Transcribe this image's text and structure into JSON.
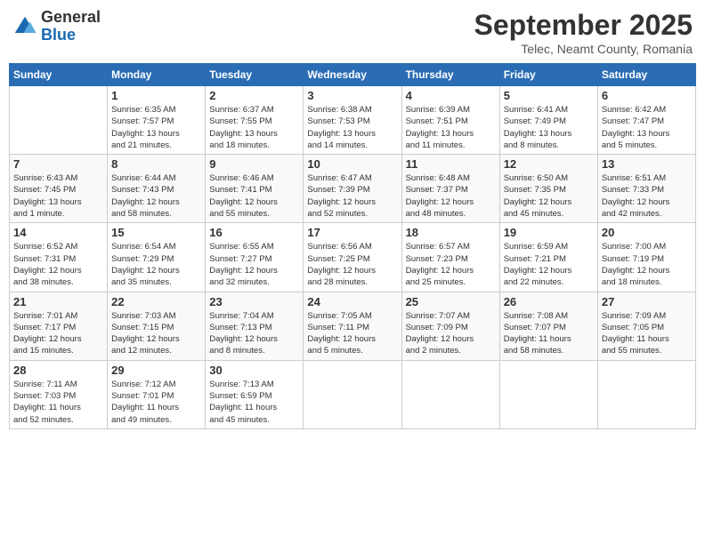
{
  "header": {
    "logo_general": "General",
    "logo_blue": "Blue",
    "month_title": "September 2025",
    "subtitle": "Telec, Neamt County, Romania"
  },
  "days_of_week": [
    "Sunday",
    "Monday",
    "Tuesday",
    "Wednesday",
    "Thursday",
    "Friday",
    "Saturday"
  ],
  "weeks": [
    [
      {
        "day": "",
        "info": ""
      },
      {
        "day": "1",
        "info": "Sunrise: 6:35 AM\nSunset: 7:57 PM\nDaylight: 13 hours\nand 21 minutes."
      },
      {
        "day": "2",
        "info": "Sunrise: 6:37 AM\nSunset: 7:55 PM\nDaylight: 13 hours\nand 18 minutes."
      },
      {
        "day": "3",
        "info": "Sunrise: 6:38 AM\nSunset: 7:53 PM\nDaylight: 13 hours\nand 14 minutes."
      },
      {
        "day": "4",
        "info": "Sunrise: 6:39 AM\nSunset: 7:51 PM\nDaylight: 13 hours\nand 11 minutes."
      },
      {
        "day": "5",
        "info": "Sunrise: 6:41 AM\nSunset: 7:49 PM\nDaylight: 13 hours\nand 8 minutes."
      },
      {
        "day": "6",
        "info": "Sunrise: 6:42 AM\nSunset: 7:47 PM\nDaylight: 13 hours\nand 5 minutes."
      }
    ],
    [
      {
        "day": "7",
        "info": "Sunrise: 6:43 AM\nSunset: 7:45 PM\nDaylight: 13 hours\nand 1 minute."
      },
      {
        "day": "8",
        "info": "Sunrise: 6:44 AM\nSunset: 7:43 PM\nDaylight: 12 hours\nand 58 minutes."
      },
      {
        "day": "9",
        "info": "Sunrise: 6:46 AM\nSunset: 7:41 PM\nDaylight: 12 hours\nand 55 minutes."
      },
      {
        "day": "10",
        "info": "Sunrise: 6:47 AM\nSunset: 7:39 PM\nDaylight: 12 hours\nand 52 minutes."
      },
      {
        "day": "11",
        "info": "Sunrise: 6:48 AM\nSunset: 7:37 PM\nDaylight: 12 hours\nand 48 minutes."
      },
      {
        "day": "12",
        "info": "Sunrise: 6:50 AM\nSunset: 7:35 PM\nDaylight: 12 hours\nand 45 minutes."
      },
      {
        "day": "13",
        "info": "Sunrise: 6:51 AM\nSunset: 7:33 PM\nDaylight: 12 hours\nand 42 minutes."
      }
    ],
    [
      {
        "day": "14",
        "info": "Sunrise: 6:52 AM\nSunset: 7:31 PM\nDaylight: 12 hours\nand 38 minutes."
      },
      {
        "day": "15",
        "info": "Sunrise: 6:54 AM\nSunset: 7:29 PM\nDaylight: 12 hours\nand 35 minutes."
      },
      {
        "day": "16",
        "info": "Sunrise: 6:55 AM\nSunset: 7:27 PM\nDaylight: 12 hours\nand 32 minutes."
      },
      {
        "day": "17",
        "info": "Sunrise: 6:56 AM\nSunset: 7:25 PM\nDaylight: 12 hours\nand 28 minutes."
      },
      {
        "day": "18",
        "info": "Sunrise: 6:57 AM\nSunset: 7:23 PM\nDaylight: 12 hours\nand 25 minutes."
      },
      {
        "day": "19",
        "info": "Sunrise: 6:59 AM\nSunset: 7:21 PM\nDaylight: 12 hours\nand 22 minutes."
      },
      {
        "day": "20",
        "info": "Sunrise: 7:00 AM\nSunset: 7:19 PM\nDaylight: 12 hours\nand 18 minutes."
      }
    ],
    [
      {
        "day": "21",
        "info": "Sunrise: 7:01 AM\nSunset: 7:17 PM\nDaylight: 12 hours\nand 15 minutes."
      },
      {
        "day": "22",
        "info": "Sunrise: 7:03 AM\nSunset: 7:15 PM\nDaylight: 12 hours\nand 12 minutes."
      },
      {
        "day": "23",
        "info": "Sunrise: 7:04 AM\nSunset: 7:13 PM\nDaylight: 12 hours\nand 8 minutes."
      },
      {
        "day": "24",
        "info": "Sunrise: 7:05 AM\nSunset: 7:11 PM\nDaylight: 12 hours\nand 5 minutes."
      },
      {
        "day": "25",
        "info": "Sunrise: 7:07 AM\nSunset: 7:09 PM\nDaylight: 12 hours\nand 2 minutes."
      },
      {
        "day": "26",
        "info": "Sunrise: 7:08 AM\nSunset: 7:07 PM\nDaylight: 11 hours\nand 58 minutes."
      },
      {
        "day": "27",
        "info": "Sunrise: 7:09 AM\nSunset: 7:05 PM\nDaylight: 11 hours\nand 55 minutes."
      }
    ],
    [
      {
        "day": "28",
        "info": "Sunrise: 7:11 AM\nSunset: 7:03 PM\nDaylight: 11 hours\nand 52 minutes."
      },
      {
        "day": "29",
        "info": "Sunrise: 7:12 AM\nSunset: 7:01 PM\nDaylight: 11 hours\nand 49 minutes."
      },
      {
        "day": "30",
        "info": "Sunrise: 7:13 AM\nSunset: 6:59 PM\nDaylight: 11 hours\nand 45 minutes."
      },
      {
        "day": "",
        "info": ""
      },
      {
        "day": "",
        "info": ""
      },
      {
        "day": "",
        "info": ""
      },
      {
        "day": "",
        "info": ""
      }
    ]
  ]
}
